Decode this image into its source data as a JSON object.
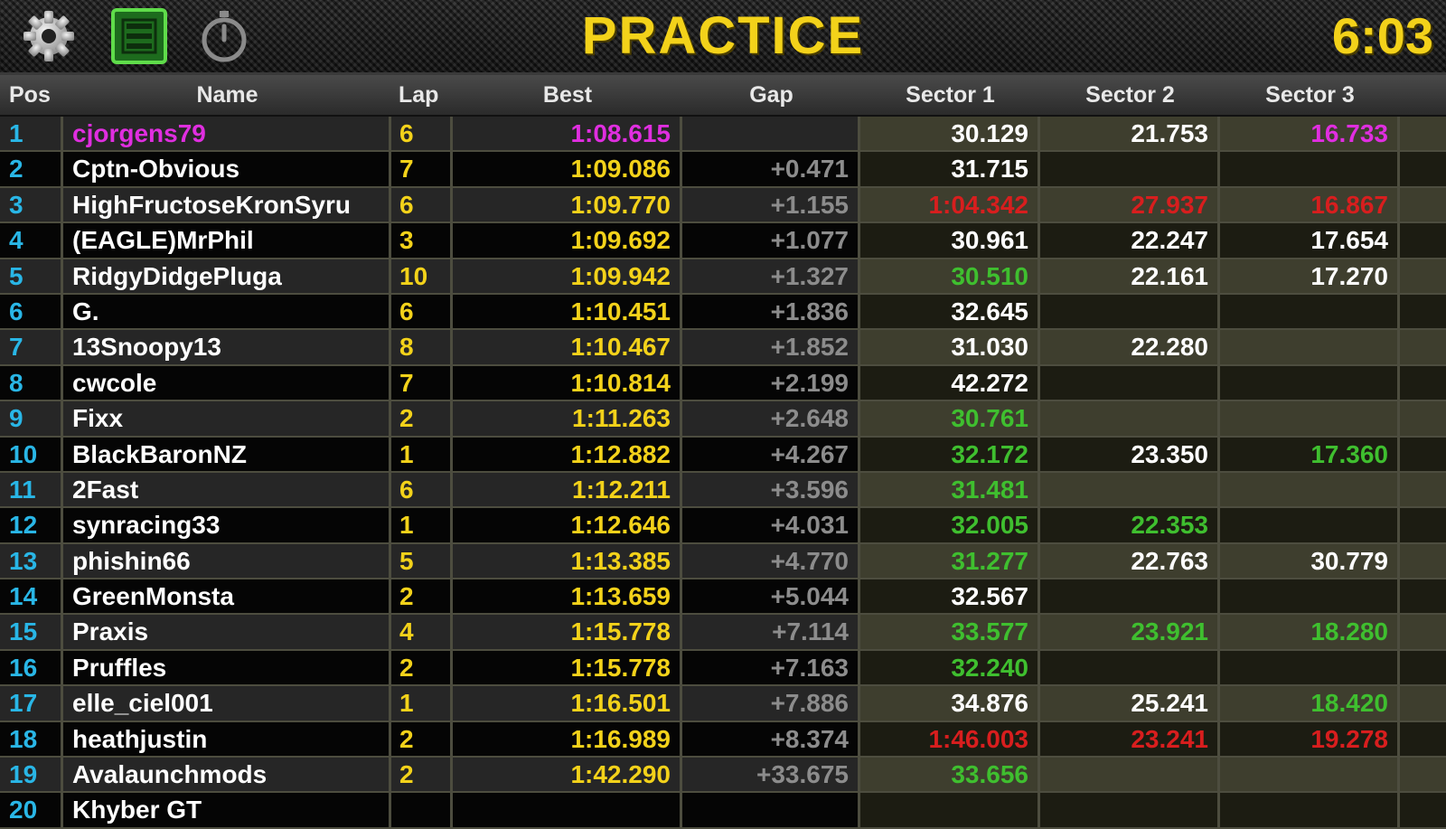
{
  "header": {
    "title": "PRACTICE",
    "clock": "6:03",
    "icons": [
      "gear-icon",
      "list-icon",
      "stopwatch-icon"
    ]
  },
  "colors": {
    "accent_yellow": "#f3d21a",
    "pos_blue": "#29b6e6",
    "personal_best_green": "#3fbf2f",
    "overall_best_magenta": "#e02ee0",
    "slow_red": "#d81e1e",
    "gap_grey": "#8c8c8c"
  },
  "columns": [
    "Pos",
    "Name",
    "Lap",
    "Best",
    "Gap",
    "Sector 1",
    "Sector 2",
    "Sector 3"
  ],
  "rows": [
    {
      "pos": "1",
      "name": "cjorgens79",
      "lap": "6",
      "best": "1:08.615",
      "gap": "",
      "s1": "30.129",
      "s2": "21.753",
      "s3": "16.733",
      "name_color": "magenta",
      "best_color": "magenta",
      "s1_color": "white",
      "s2_color": "white",
      "s3_color": "magenta"
    },
    {
      "pos": "2",
      "name": "Cptn-Obvious",
      "lap": "7",
      "best": "1:09.086",
      "gap": "+0.471",
      "s1": "31.715",
      "s2": "",
      "s3": "",
      "s1_color": "white"
    },
    {
      "pos": "3",
      "name": "HighFructoseKronSyru",
      "lap": "6",
      "best": "1:09.770",
      "gap": "+1.155",
      "s1": "1:04.342",
      "s2": "27.937",
      "s3": "16.867",
      "s1_color": "red",
      "s2_color": "red",
      "s3_color": "red"
    },
    {
      "pos": "4",
      "name": "(EAGLE)MrPhil",
      "lap": "3",
      "best": "1:09.692",
      "gap": "+1.077",
      "s1": "30.961",
      "s2": "22.247",
      "s3": "17.654",
      "s1_color": "white",
      "s2_color": "white",
      "s3_color": "white"
    },
    {
      "pos": "5",
      "name": "RidgyDidgePluga",
      "lap": "10",
      "best": "1:09.942",
      "gap": "+1.327",
      "s1": "30.510",
      "s2": "22.161",
      "s3": "17.270",
      "s1_color": "green",
      "s2_color": "white",
      "s3_color": "white"
    },
    {
      "pos": "6",
      "name": "G.",
      "lap": "6",
      "best": "1:10.451",
      "gap": "+1.836",
      "s1": "32.645",
      "s2": "",
      "s3": "",
      "s1_color": "white"
    },
    {
      "pos": "7",
      "name": "13Snoopy13",
      "lap": "8",
      "best": "1:10.467",
      "gap": "+1.852",
      "s1": "31.030",
      "s2": "22.280",
      "s3": "",
      "s1_color": "white",
      "s2_color": "white"
    },
    {
      "pos": "8",
      "name": "cwcole",
      "lap": "7",
      "best": "1:10.814",
      "gap": "+2.199",
      "s1": "42.272",
      "s2": "",
      "s3": "",
      "s1_color": "white"
    },
    {
      "pos": "9",
      "name": "Fixx",
      "lap": "2",
      "best": "1:11.263",
      "gap": "+2.648",
      "s1": "30.761",
      "s2": "",
      "s3": "",
      "s1_color": "green"
    },
    {
      "pos": "10",
      "name": "BlackBaronNZ",
      "lap": "1",
      "best": "1:12.882",
      "gap": "+4.267",
      "s1": "32.172",
      "s2": "23.350",
      "s3": "17.360",
      "s1_color": "green",
      "s2_color": "white",
      "s3_color": "green"
    },
    {
      "pos": "11",
      "name": "2Fast",
      "lap": "6",
      "best": "1:12.211",
      "gap": "+3.596",
      "s1": "31.481",
      "s2": "",
      "s3": "",
      "s1_color": "green"
    },
    {
      "pos": "12",
      "name": "synracing33",
      "lap": "1",
      "best": "1:12.646",
      "gap": "+4.031",
      "s1": "32.005",
      "s2": "22.353",
      "s3": "",
      "s1_color": "green",
      "s2_color": "green"
    },
    {
      "pos": "13",
      "name": "phishin66",
      "lap": "5",
      "best": "1:13.385",
      "gap": "+4.770",
      "s1": "31.277",
      "s2": "22.763",
      "s3": "30.779",
      "s1_color": "green",
      "s2_color": "white",
      "s3_color": "white"
    },
    {
      "pos": "14",
      "name": "GreenMonsta",
      "lap": "2",
      "best": "1:13.659",
      "gap": "+5.044",
      "s1": "32.567",
      "s2": "",
      "s3": "",
      "s1_color": "white"
    },
    {
      "pos": "15",
      "name": "Praxis",
      "lap": "4",
      "best": "1:15.778",
      "gap": "+7.114",
      "s1": "33.577",
      "s2": "23.921",
      "s3": "18.280",
      "s1_color": "green",
      "s2_color": "green",
      "s3_color": "green"
    },
    {
      "pos": "16",
      "name": "Pruffles",
      "lap": "2",
      "best": "1:15.778",
      "gap": "+7.163",
      "s1": "32.240",
      "s2": "",
      "s3": "",
      "s1_color": "green"
    },
    {
      "pos": "17",
      "name": "elle_ciel001",
      "lap": "1",
      "best": "1:16.501",
      "gap": "+7.886",
      "s1": "34.876",
      "s2": "25.241",
      "s3": "18.420",
      "s1_color": "white",
      "s2_color": "white",
      "s3_color": "green"
    },
    {
      "pos": "18",
      "name": "heathjustin",
      "lap": "2",
      "best": "1:16.989",
      "gap": "+8.374",
      "s1": "1:46.003",
      "s2": "23.241",
      "s3": "19.278",
      "s1_color": "red",
      "s2_color": "red",
      "s3_color": "red"
    },
    {
      "pos": "19",
      "name": "Avalaunchmods",
      "lap": "2",
      "best": "1:42.290",
      "gap": "+33.675",
      "s1": "33.656",
      "s2": "",
      "s3": "",
      "s1_color": "green"
    },
    {
      "pos": "20",
      "name": "Khyber GT",
      "lap": "",
      "best": "",
      "gap": "",
      "s1": "",
      "s2": "",
      "s3": ""
    }
  ]
}
